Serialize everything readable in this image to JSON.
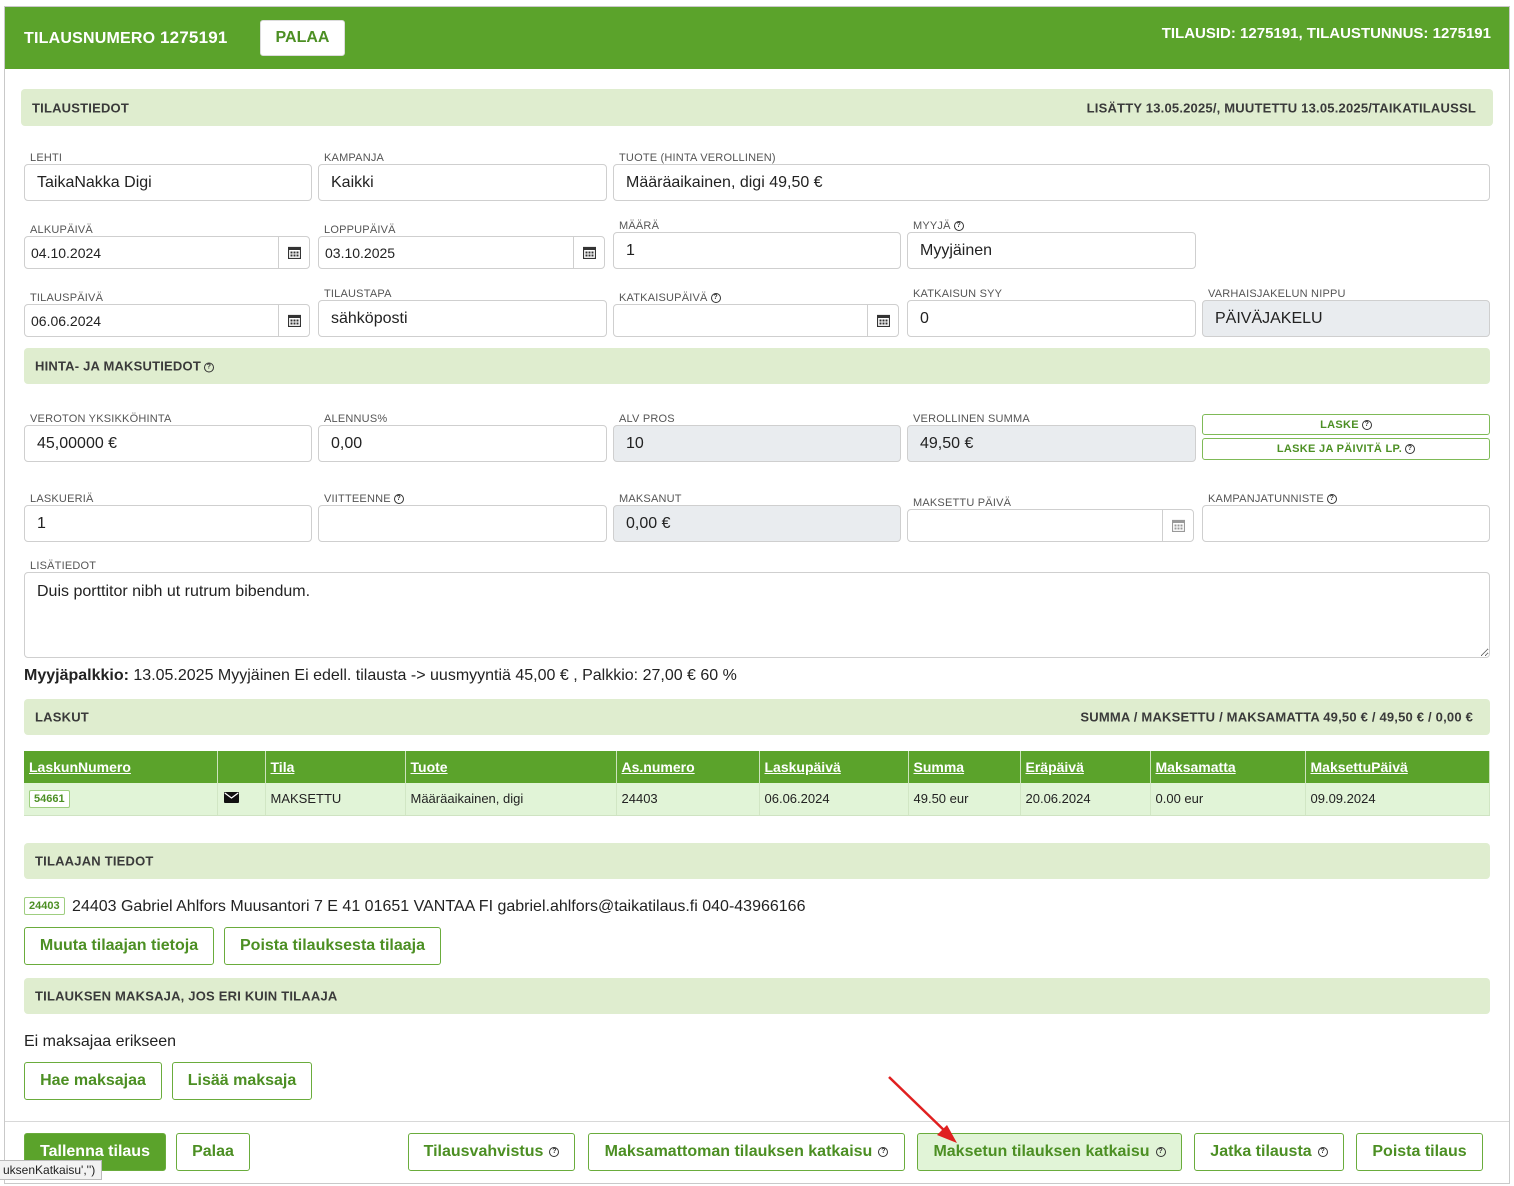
{
  "header": {
    "title_prefix": "TILAUSNUMERO",
    "order_number": "1275191",
    "back_label": "PALAA",
    "ids": "TILAUSID: 1275191, TILAUSTUNNUS: 1275191"
  },
  "order_info": {
    "title": "TILAUSTIEDOT",
    "meta": "LISÄTTY 13.05.2025/, MUUTETTU 13.05.2025/TAIKATILAUSSL"
  },
  "fields": {
    "lehti": {
      "label": "LEHTI",
      "value": "TaikaNakka Digi"
    },
    "kampanja": {
      "label": "KAMPANJA",
      "value": "Kaikki"
    },
    "tuote": {
      "label": "TUOTE (HINTA VEROLLINEN)",
      "value": "Määräaikainen, digi 49,50 €"
    },
    "alkupaiva": {
      "label": "ALKUPÄIVÄ",
      "value": "04.10.2024"
    },
    "loppupaiva": {
      "label": "LOPPUPÄIVÄ",
      "value": "03.10.2025"
    },
    "maara": {
      "label": "MÄÄRÄ",
      "value": "1"
    },
    "myyja": {
      "label": "MYYJÄ",
      "value": "Myyjäinen"
    },
    "tilauspaiva": {
      "label": "TILAUSPÄIVÄ",
      "value": "06.06.2024"
    },
    "tilaustapa": {
      "label": "TILAUSTAPA",
      "value": "sähköposti"
    },
    "katkaisupaiva": {
      "label": "KATKAISUPÄIVÄ",
      "value": ""
    },
    "katkaisun_syy": {
      "label": "KATKAISUN SYY",
      "value": "0"
    },
    "varhaisjakelun_nippu": {
      "label": "VARHAISJAKELUN NIPPU",
      "value": "PÄIVÄJAKELU"
    }
  },
  "price_info": {
    "title": "HINTA- JA MAKSUTIEDOT",
    "veroton": {
      "label": "VEROTON YKSIKKÖHINTA",
      "value": "45,00000 €"
    },
    "alennus": {
      "label": "ALENNUS%",
      "value": "0,00"
    },
    "alv": {
      "label": "ALV PROS",
      "value": "10"
    },
    "verollinen": {
      "label": "VEROLLINEN SUMMA",
      "value": "49,50 €"
    },
    "laske_label": "LASKE",
    "laske_paivita_label": "LASKE JA PÄIVITÄ LP.",
    "laskueria": {
      "label": "LASKUERIÄ",
      "value": "1"
    },
    "viitteenne": {
      "label": "VIITTEENNE",
      "value": ""
    },
    "maksanut": {
      "label": "MAKSANUT",
      "value": "0,00 €"
    },
    "maksettu_paiva": {
      "label": "MAKSETTU PÄIVÄ",
      "value": ""
    },
    "kampanjatunniste": {
      "label": "KAMPANJATUNNISTE",
      "value": ""
    }
  },
  "lisatiedot": {
    "label": "LISÄTIEDOT",
    "value": "Duis porttitor nibh ut rutrum bibendum."
  },
  "seller_commission": {
    "label": "Myyjäpalkkio:",
    "text": "13.05.2025 Myyjäinen Ei edell. tilausta -> uusmyyntiä 45,00 € , Palkkio: 27,00 € 60 %"
  },
  "invoices": {
    "title": "LASKUT",
    "summary": "SUMMA / MAKSETTU / MAKSAMATTA 49,50 € / 49,50 € / 0,00 €",
    "columns": [
      "LaskunNumero",
      "",
      "Tila",
      "Tuote",
      "As.numero",
      "Laskupäivä",
      "Summa",
      "Eräpäivä",
      "Maksamatta",
      "MaksettuPäivä"
    ],
    "rows": [
      {
        "number": "54661",
        "status": "MAKSETTU",
        "product": "Määräaikainen, digi",
        "customer": "24403",
        "invoice_date": "06.06.2024",
        "sum": "49.50 eur",
        "due_date": "20.06.2024",
        "unpaid": "0.00 eur",
        "paid_date": "09.09.2024"
      }
    ]
  },
  "customer": {
    "title": "TILAAJAN TIEDOT",
    "chip": "24403",
    "text": "24403 Gabriel Ahlfors Muusantori 7 E 41 01651 VANTAA FI gabriel.ahlfors@taikatilaus.fi 040-43966166",
    "edit_label": "Muuta tilaajan tietoja",
    "remove_label": "Poista tilauksesta tilaaja"
  },
  "payer": {
    "title": "TILAUKSEN MAKSAJA, JOS ERI KUIN TILAAJA",
    "text": "Ei maksajaa erikseen",
    "fetch_label": "Hae maksajaa",
    "add_label": "Lisää maksaja"
  },
  "footer": {
    "save_label": "Tallenna tilaus",
    "back_label": "Palaa",
    "confirm_label": "Tilausvahvistus",
    "cancel_unpaid_label": "Maksamattoman tilauksen katkaisu",
    "cancel_paid_label": "Maksetun tilauksen katkaisu",
    "continue_label": "Jatka tilausta",
    "delete_label": "Poista tilaus"
  },
  "status_tooltip": "uksenKatkaisu','')",
  "colors": {
    "brand": "#5ba32b",
    "section": "#dfedcf",
    "row": "#e1f4d7",
    "arrow": "#e02020"
  }
}
